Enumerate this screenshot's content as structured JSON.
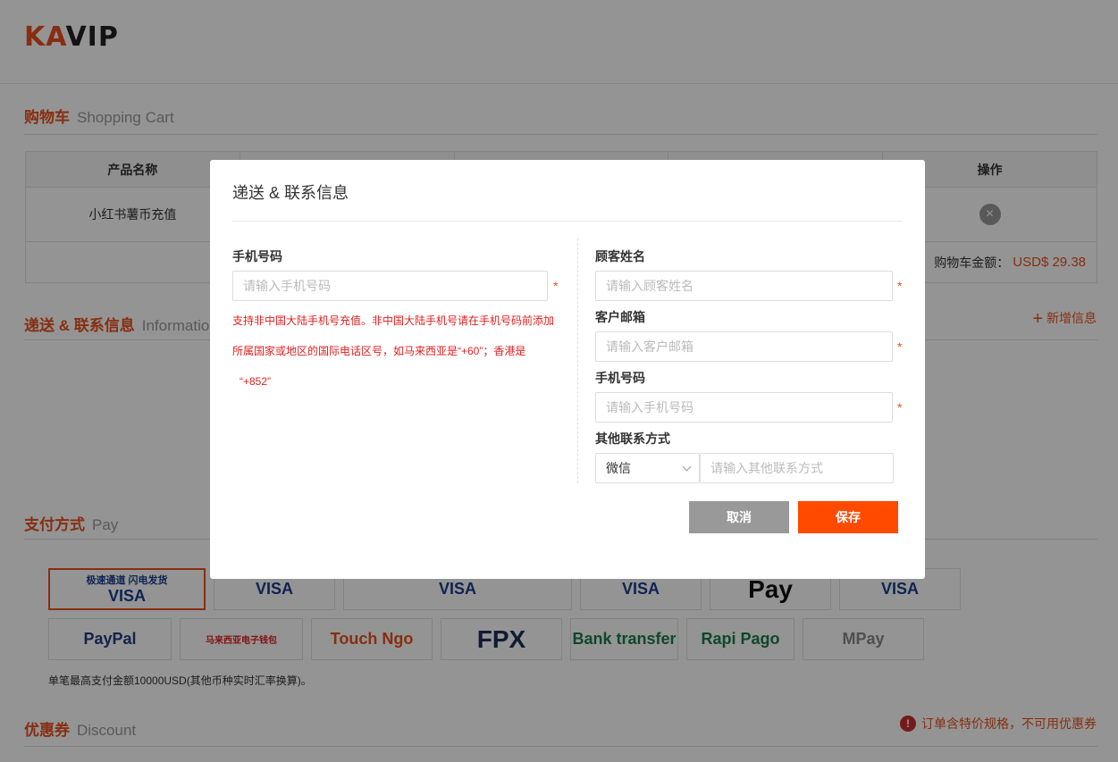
{
  "logo": {
    "part1": "KA",
    "part2": "VIP"
  },
  "cart": {
    "title_cn": "购物车",
    "title_en": "Shopping Cart",
    "columns": [
      "产品名称",
      "",
      "",
      "",
      "操作"
    ],
    "product_name": "小红书薯币充值",
    "total_label": "购物车金额：",
    "total_value": "USD$ 29.38"
  },
  "delivery": {
    "title_cn": "递送 & 联系信息",
    "title_en": "Information",
    "add_label": "新增信息"
  },
  "payment": {
    "title_cn": "支付方式",
    "title_en": "Pay",
    "row1": [
      {
        "label": "VISA",
        "sub": "极速通道 闪电发货",
        "selected": true
      },
      {
        "label": "VISA"
      },
      {
        "label": "VISA"
      },
      {
        "label": "VISA"
      },
      {
        "label": "Pay"
      },
      {
        "label": "VISA"
      }
    ],
    "row2": [
      {
        "label": "PayPal"
      },
      {
        "label": "马来西亚电子钱包"
      },
      {
        "label": "Touch Ngo"
      },
      {
        "label": "FPX"
      },
      {
        "label": "Bank transfer"
      },
      {
        "label": "Rapi Pago"
      },
      {
        "label": "MPay"
      }
    ],
    "note": "单笔最高支付金额10000USD(其他币种实时汇率换算)。"
  },
  "discount": {
    "title_cn": "优惠券",
    "title_en": "Discount",
    "warning": "订单含特价规格，不可用优惠券"
  },
  "modal": {
    "title": "递送 & 联系信息",
    "left": {
      "phone_label": "手机号码",
      "phone_placeholder": "请输入手机号码",
      "hint_line1": "支持非中国大陆手机号充值。非中国大陆手机号请在手机号码前添加",
      "hint_line2": "所属国家或地区的国际电话区号，如马来西亚是“+60”；香港是",
      "hint_line3": "“+852”"
    },
    "right": {
      "name_label": "顾客姓名",
      "name_placeholder": "请输入顾客姓名",
      "email_label": "客户邮箱",
      "email_placeholder": "请输入客户邮箱",
      "phone_label": "手机号码",
      "phone_placeholder": "请输入手机号码",
      "other_label": "其他联系方式",
      "other_select": "微信",
      "other_placeholder": "请输入其他联系方式"
    },
    "required_mark": "*",
    "cancel_label": "取消",
    "save_label": "保存"
  },
  "colors": {
    "accent": "#e8501e",
    "save_button": "#ff4a00",
    "cancel_button": "#999999"
  }
}
